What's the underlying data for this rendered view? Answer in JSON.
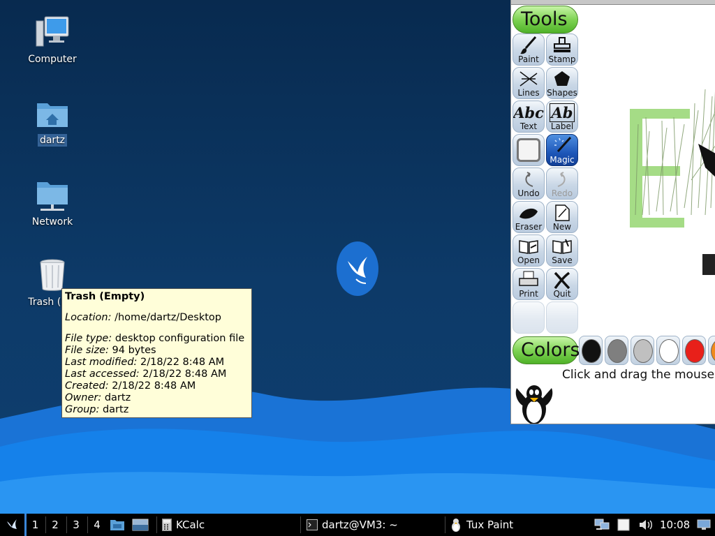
{
  "desktop": {
    "icons": [
      {
        "label": "Computer",
        "icon": "computer-icon"
      },
      {
        "label": "dartz",
        "icon": "home-folder-icon"
      },
      {
        "label": "Network",
        "icon": "network-folder-icon"
      },
      {
        "label": "Trash (Em",
        "icon": "trash-icon"
      }
    ]
  },
  "tooltip": {
    "title": "Trash (Empty)",
    "location_label": "Location:",
    "location_value": " /home/dartz/Desktop",
    "filetype_label": "File type:",
    "filetype_value": " desktop configuration file",
    "filesize_label": "File size:",
    "filesize_value": " 94 bytes",
    "modified_label": "Last modified:",
    "modified_value": " 2/18/22 8:48 AM",
    "accessed_label": "Last accessed:",
    "accessed_value": " 2/18/22 8:48 AM",
    "created_label": "Created:",
    "created_value": " 2/18/22 8:48 AM",
    "owner_label": "Owner:",
    "owner_value": " dartz",
    "group_label": "Group:",
    "group_value": " dartz"
  },
  "tuxpaint": {
    "tools_title": "Tools",
    "colors_title": "Colors",
    "tools": {
      "paint": "Paint",
      "stamp": "Stamp",
      "lines": "Lines",
      "shapes": "Shapes",
      "text": "Text",
      "label": "Label",
      "magic": "Magic",
      "undo": "Undo",
      "redo": "Redo",
      "eraser": "Eraser",
      "new": "New",
      "open": "Open",
      "save": "Save",
      "print": "Print",
      "quit": "Quit"
    },
    "text_glyph": "Abc",
    "label_glyph": "Ab",
    "swatch_colors": [
      "#111111",
      "#7f7f7f",
      "#c0c0c0",
      "#ffffff",
      "#e8201a",
      "#f08a1c"
    ],
    "status": "Click and drag the mouse"
  },
  "taskbar": {
    "workspaces": [
      "1",
      "2",
      "3",
      "4"
    ],
    "tasks": [
      {
        "label": "KCalc",
        "icon": "calculator-icon"
      },
      {
        "label": "dartz@VM3: ~",
        "icon": "terminal-icon"
      },
      {
        "label": "Tux Paint",
        "icon": "tuxpaint-icon"
      }
    ],
    "clock": "10:08",
    "accent": "#3a86d8"
  }
}
